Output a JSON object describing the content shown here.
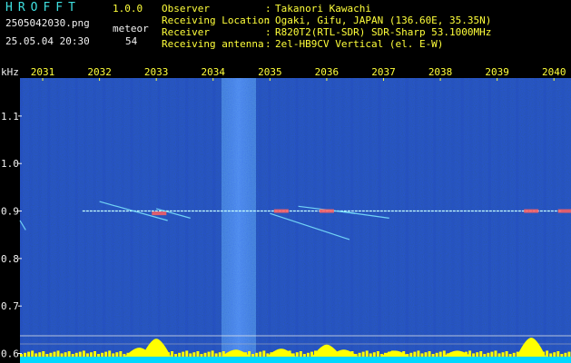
{
  "header": {
    "app_title": "HROFFT",
    "app_version": "1.0.0",
    "file_name": "2505042030.png",
    "capture_time": "25.05.04 20:30",
    "detect_label": "meteor",
    "detect_count": "54",
    "info": [
      {
        "key": "Observer",
        "value": "Takanori Kawachi"
      },
      {
        "key": "Receiving Location",
        "value": "Ogaki, Gifu, JAPAN (136.60E, 35.35N)"
      },
      {
        "key": "Receiver",
        "value": "R820T2(RTL-SDR) SDR-Sharp 53.1000MHz"
      },
      {
        "key": "Receiving antenna",
        "value": "2el-HB9CV Vertical (el. E-W)"
      }
    ]
  },
  "colors": {
    "background": "#000000",
    "noise": "#1428a0",
    "carrier": "#c8ffff",
    "meteor": "#ff6060",
    "activity_bar": "#ffff00",
    "baseline": "#00d8ff",
    "tick_label": "#ffff3a",
    "axis_label": "#f2f2f2"
  },
  "chart_data": {
    "type": "heatmap",
    "ylabel": "kHz",
    "x_ticks": [
      "2031",
      "2032",
      "2033",
      "2034",
      "2035",
      "2036",
      "2037",
      "2038",
      "2039",
      "2040"
    ],
    "y_ticks": [
      "1.1",
      "1.0",
      "0.9",
      "0.8",
      "0.7",
      "0.6"
    ],
    "y_tick_values": [
      1.1,
      1.0,
      0.9,
      0.8,
      0.7,
      0.6
    ],
    "xlim": [
      2030.6,
      2040.3
    ],
    "ylim": [
      0.58,
      1.18
    ],
    "carrier_khz": 0.9,
    "meteor_traces": [
      {
        "x": [
          2032.0,
          2033.2
        ],
        "y": [
          0.92,
          0.88
        ]
      },
      {
        "x": [
          2033.0,
          2033.6
        ],
        "y": [
          0.905,
          0.885
        ]
      },
      {
        "x": [
          2035.0,
          2036.4
        ],
        "y": [
          0.895,
          0.84
        ]
      },
      {
        "x": [
          2035.5,
          2036.5
        ],
        "y": [
          0.91,
          0.895
        ]
      },
      {
        "x": [
          2036.2,
          2037.1
        ],
        "y": [
          0.9,
          0.885
        ]
      },
      {
        "x": [
          2030.6,
          2030.7
        ],
        "y": [
          0.88,
          0.86
        ]
      }
    ],
    "meteor_bursts": [
      {
        "x": 2033.05,
        "y": 0.895
      },
      {
        "x": 2035.2,
        "y": 0.9
      },
      {
        "x": 2036.0,
        "y": 0.9
      },
      {
        "x": 2039.6,
        "y": 0.9
      },
      {
        "x": 2040.2,
        "y": 0.9
      }
    ],
    "activity": [
      {
        "x": 2033.0,
        "level": 0.9
      },
      {
        "x": 2032.7,
        "level": 0.45
      },
      {
        "x": 2034.4,
        "level": 0.35
      },
      {
        "x": 2035.2,
        "level": 0.4
      },
      {
        "x": 2036.0,
        "level": 0.6
      },
      {
        "x": 2036.3,
        "level": 0.35
      },
      {
        "x": 2037.2,
        "level": 0.3
      },
      {
        "x": 2038.3,
        "level": 0.3
      },
      {
        "x": 2039.6,
        "level": 0.95
      }
    ]
  }
}
